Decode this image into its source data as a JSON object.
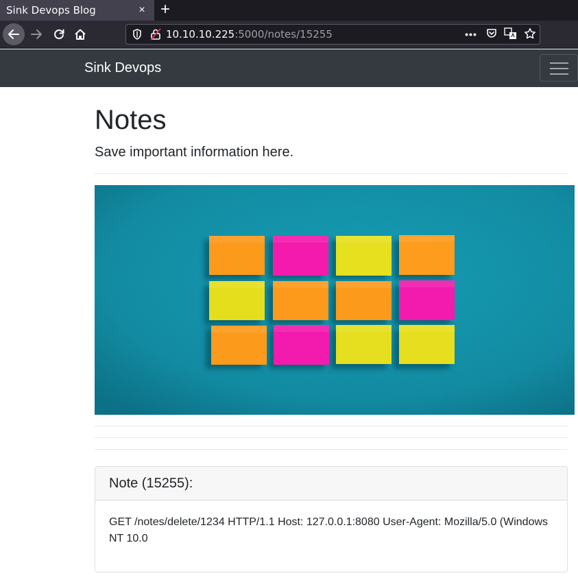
{
  "browser": {
    "tab_title": "Sink Devops Blog",
    "tab_close": "×",
    "new_tab": "+",
    "url_host": "10.10.10.225",
    "url_rest": ":5000/notes/15255",
    "icons": [
      "back-arrow-icon",
      "forward-arrow-icon",
      "reload-icon",
      "home-icon",
      "shield-icon",
      "insecure-lock-icon",
      "more-dots-icon",
      "pocket-icon",
      "translate-icon",
      "bookmark-star-icon"
    ]
  },
  "site": {
    "brand": "Sink Devops",
    "menu_icon": "hamburger-icon"
  },
  "page": {
    "title": "Notes",
    "lead": "Save important information here."
  },
  "hero": {
    "description": "sticky-notes-on-teal-wall",
    "background_color": "#1597b1",
    "note_colors": [
      "#fd9a1d",
      "#f41ab0",
      "#e8df1f"
    ]
  },
  "note": {
    "header": "Note (15255):",
    "body": "GET /notes/delete/1234 HTTP/1.1 Host: 127.0.0.1:8080 User-Agent: Mozilla/5.0 (Windows NT 10.0"
  }
}
